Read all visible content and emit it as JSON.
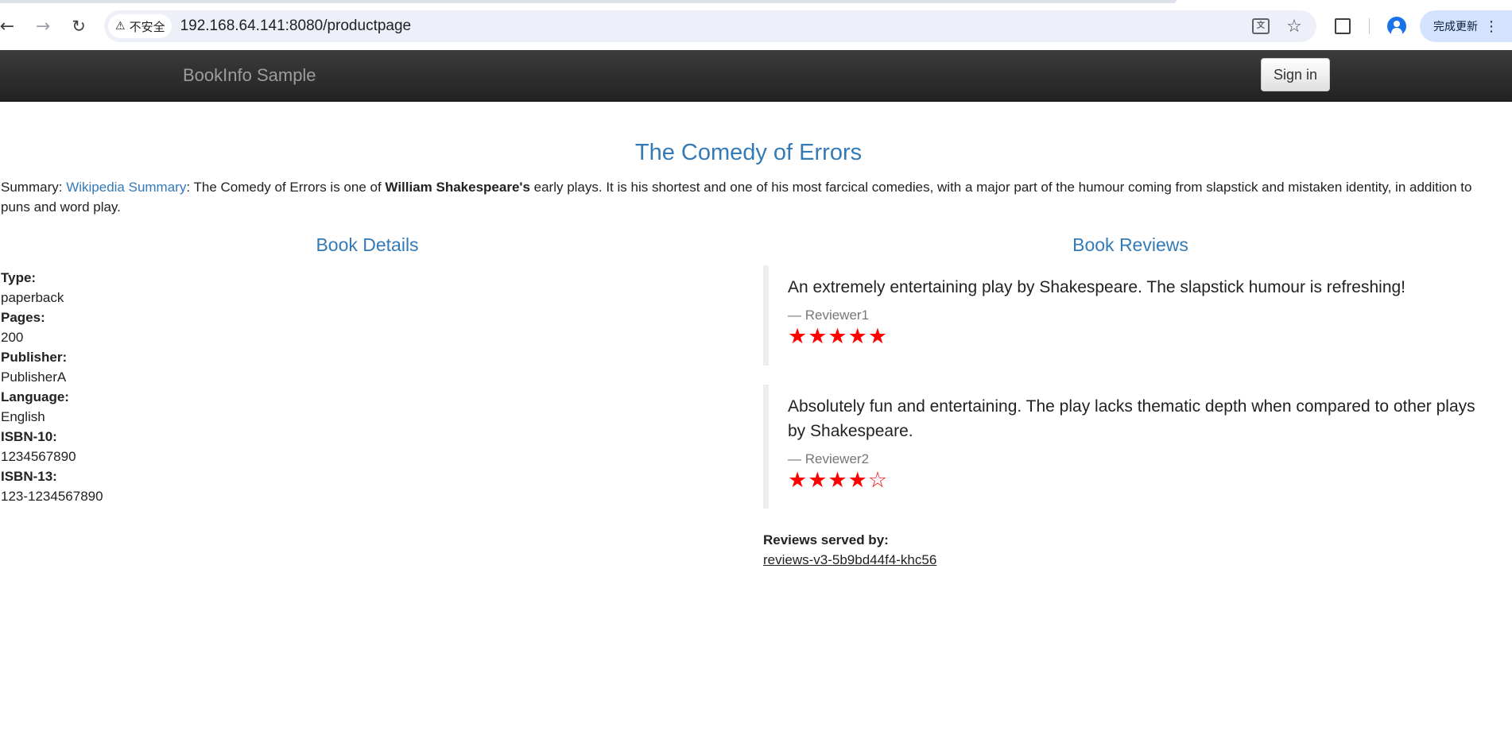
{
  "browser": {
    "security_label": "不安全",
    "url": "192.168.64.141:8080/productpage",
    "update_label": "完成更新"
  },
  "navbar": {
    "brand": "BookInfo Sample",
    "signin_label": "Sign in"
  },
  "product": {
    "title": "The Comedy of Errors",
    "summary_prefix": "Summary: ",
    "summary_link": "Wikipedia Summary",
    "summary_mid": ": The Comedy of Errors is one of ",
    "summary_bold": "William Shakespeare's",
    "summary_rest": " early plays. It is his shortest and one of his most farcical comedies, with a major part of the humour coming from slapstick and mistaken identity, in addition to puns and word play."
  },
  "details": {
    "heading": "Book Details",
    "type_label": "Type:",
    "type_value": "paperback",
    "pages_label": "Pages:",
    "pages_value": "200",
    "publisher_label": "Publisher:",
    "publisher_value": "PublisherA",
    "language_label": "Language:",
    "language_value": "English",
    "isbn10_label": "ISBN-10:",
    "isbn10_value": "1234567890",
    "isbn13_label": "ISBN-13:",
    "isbn13_value": "123-1234567890"
  },
  "reviews": {
    "heading": "Book Reviews",
    "items": [
      {
        "text": "An extremely entertaining play by Shakespeare. The slapstick humour is refreshing!",
        "author": "— Reviewer1",
        "stars": "★★★★★",
        "rating": 5,
        "star_color": "#ff0000"
      },
      {
        "text": "Absolutely fun and entertaining. The play lacks thematic depth when compared to other plays by Shakespeare.",
        "author": "— Reviewer2",
        "stars": "★★★★☆",
        "rating": 4,
        "star_color": "#ff0000"
      }
    ],
    "served_label": "Reviews served by:",
    "served_value": "reviews-v3-5b9bd44f4-khc56"
  },
  "icons": {
    "back": "arrow-left-icon",
    "forward": "arrow-right-icon",
    "reload": "reload-icon",
    "warning": "warning-icon",
    "translate": "translate-icon",
    "bookmark": "star-icon",
    "extensions": "puzzle-icon",
    "profile": "profile-icon",
    "menu": "more-vert-icon"
  },
  "colors": {
    "link": "#337ab7",
    "navbar": "#222222",
    "stars": "#ff0000"
  }
}
